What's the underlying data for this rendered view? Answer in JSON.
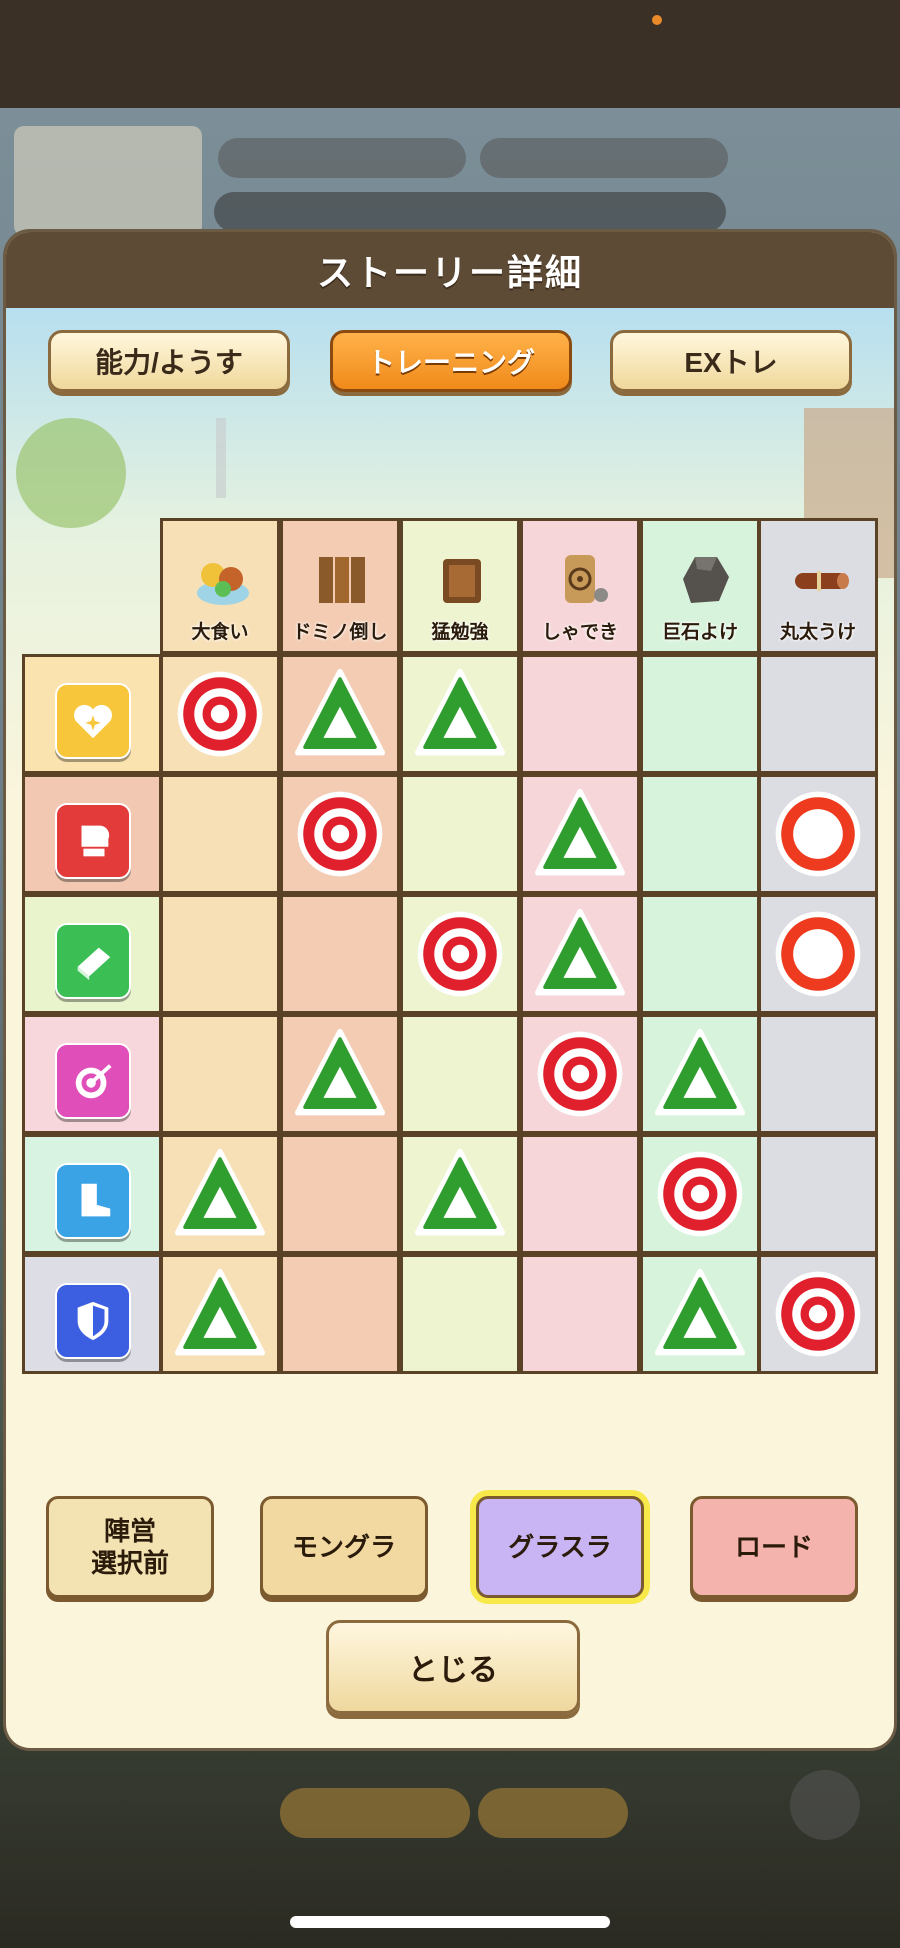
{
  "modal": {
    "title": "ストーリー詳細"
  },
  "tabs": [
    {
      "label": "能力/ようす",
      "active": false
    },
    {
      "label": "トレーニング",
      "active": true
    },
    {
      "label": "EXトレ",
      "active": false
    }
  ],
  "columns": [
    {
      "label": "大食い",
      "icon": "food-pile-icon",
      "bg": "#f7e0b6"
    },
    {
      "label": "ドミノ倒し",
      "icon": "domino-wood-icon",
      "bg": "#f3ccb3"
    },
    {
      "label": "猛勉強",
      "icon": "book-icon",
      "bg": "#eef4cf"
    },
    {
      "label": "しゃでき",
      "icon": "target-board-icon",
      "bg": "#f6d6d8"
    },
    {
      "label": "巨石よけ",
      "icon": "boulder-icon",
      "bg": "#d8f3dc"
    },
    {
      "label": "丸太うけ",
      "icon": "log-icon",
      "bg": "#dcdde3"
    }
  ],
  "rows": [
    {
      "stat": "heart-icon",
      "color": "#f7c63a",
      "bg": "#fbe3b0",
      "cells": [
        "double-circle",
        "triangle",
        "triangle",
        "",
        "",
        ""
      ]
    },
    {
      "stat": "boxing-glove-icon",
      "color": "#e33a3a",
      "bg": "#f2c8b2",
      "cells": [
        "",
        "double-circle",
        "",
        "triangle",
        "",
        "circle"
      ]
    },
    {
      "stat": "book-stat-icon",
      "color": "#3bbf55",
      "bg": "#eaf4cc",
      "cells": [
        "",
        "",
        "double-circle",
        "triangle",
        "",
        "circle"
      ]
    },
    {
      "stat": "target-icon",
      "color": "#e04fb9",
      "bg": "#f7d6dc",
      "cells": [
        "",
        "triangle",
        "",
        "double-circle",
        "triangle",
        ""
      ]
    },
    {
      "stat": "boot-icon",
      "color": "#3aa3e6",
      "bg": "#d9f3e2",
      "cells": [
        "triangle",
        "",
        "triangle",
        "",
        "double-circle",
        ""
      ]
    },
    {
      "stat": "shield-icon",
      "color": "#3b5fe0",
      "bg": "#dcdde5",
      "cells": [
        "triangle",
        "",
        "",
        "",
        "triangle",
        "double-circle"
      ]
    }
  ],
  "bottom_buttons": [
    {
      "label": "陣営\n選択前",
      "bg": "#f3e3b3"
    },
    {
      "label": "モングラ",
      "bg": "#f1d9a1"
    },
    {
      "label": "グラスラ",
      "bg": "#c9b5f3",
      "highlight": true
    },
    {
      "label": "ロード",
      "bg": "#f5b3ae"
    }
  ],
  "close_label": "とじる",
  "colors": {
    "accent": "#f08a1a",
    "frame": "#5a4226",
    "mark_red": "#e0202c",
    "mark_green": "#2f9e2f"
  }
}
